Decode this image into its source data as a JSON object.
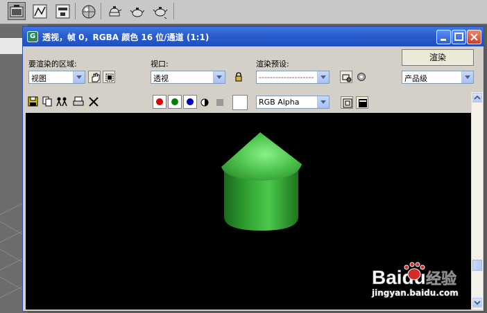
{
  "window": {
    "title": "透视，帧 0，RGBA 颜色 16 位/通道 (1:1)"
  },
  "controls": {
    "area_label": "要渲染的区域:",
    "area_value": "视图",
    "viewport_label": "视口:",
    "viewport_value": "透视",
    "preset_label": "渲染预设:",
    "preset_value": "--------------------",
    "render_button": "渲染",
    "quality_value": "产品级"
  },
  "frame_toolbar": {
    "channel_value": "RGB Alpha",
    "channel_colors": {
      "red": "#e00000",
      "green": "#008000",
      "blue": "#0000c0"
    }
  },
  "render": {
    "object_color": "#3fbe3f",
    "background_color": "#000000"
  },
  "watermark": {
    "brand": "Baidu",
    "suffix": "经验",
    "url": "jingyan.baidu.com"
  }
}
